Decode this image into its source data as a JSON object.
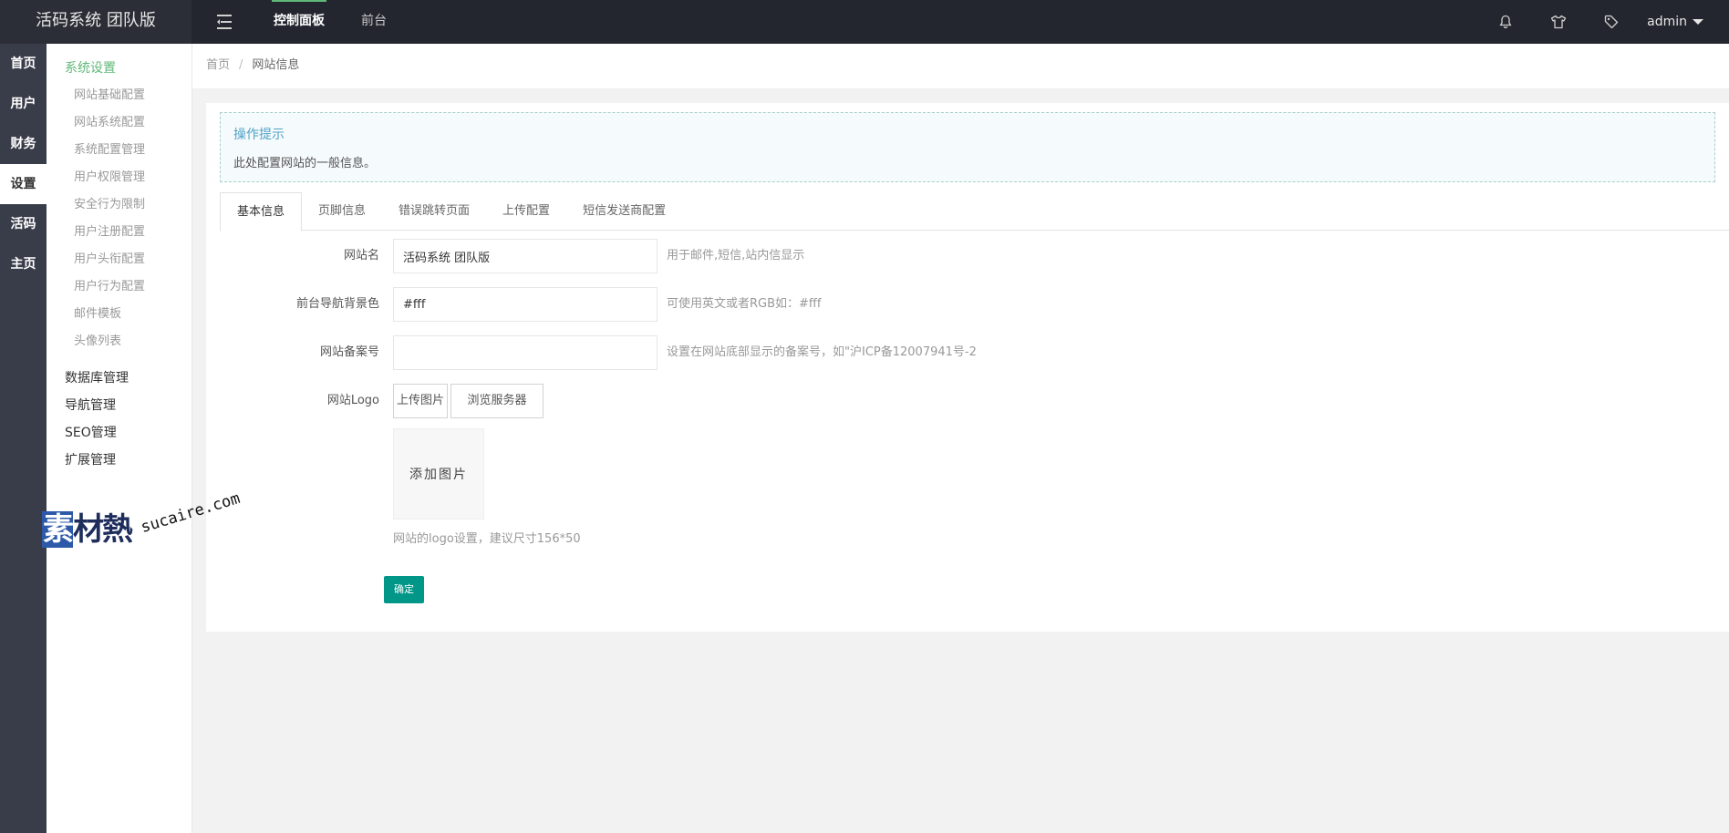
{
  "app": {
    "title": "活码系统 团队版"
  },
  "topnav": {
    "items": [
      {
        "label": "控制面板",
        "active": true
      },
      {
        "label": "前台",
        "active": false
      }
    ],
    "icons": [
      "bell-icon",
      "shirt-icon",
      "tag-icon"
    ],
    "user": "admin"
  },
  "rail": {
    "items": [
      "首页",
      "用户",
      "财务",
      "设置",
      "活码",
      "主页"
    ],
    "active_index": 3
  },
  "subnav": {
    "group_active": "系统设置",
    "items": [
      "网站基础配置",
      "网站系统配置",
      "系统配置管理",
      "用户权限管理",
      "安全行为限制",
      "用户注册配置",
      "用户头衔配置",
      "用户行为配置",
      "邮件模板",
      "头像列表"
    ],
    "groups": [
      "数据库管理",
      "导航管理",
      "SEO管理",
      "扩展管理"
    ]
  },
  "breadcrumb": {
    "home": "首页",
    "separator": "/",
    "current": "网站信息"
  },
  "tip": {
    "title": "操作提示",
    "text": "此处配置网站的一般信息。"
  },
  "tabs": [
    "基本信息",
    "页脚信息",
    "错误跳转页面",
    "上传配置",
    "短信发送商配置"
  ],
  "form": {
    "site_name": {
      "label": "网站名",
      "value": "活码系统 团队版",
      "help": "用于邮件,短信,站内信显示"
    },
    "nav_bg": {
      "label": "前台导航背景色",
      "value": "#fff",
      "help": "可使用英文或者RGB如：#fff"
    },
    "icp": {
      "label": "网站备案号",
      "value": "",
      "help": "设置在网站底部显示的备案号，如\"沪ICP备12007941号-2"
    },
    "logo": {
      "label": "网站Logo",
      "upload_label": "上传图片",
      "browse_label": "浏览服务器",
      "add_image": "添加图片",
      "help": "网站的logo设置，建议尺寸156*50"
    },
    "submit_label": "确定"
  },
  "watermark": {
    "mark": "素材熱",
    "mark_first": "素",
    "mark_rest": "材熱",
    "domain": "sucaire.com"
  },
  "colors": {
    "topbar": "#23262e",
    "rail": "#393d49",
    "accent_green": "#5fb878",
    "submit": "#009688",
    "tip_title": "#4fa3c7"
  }
}
